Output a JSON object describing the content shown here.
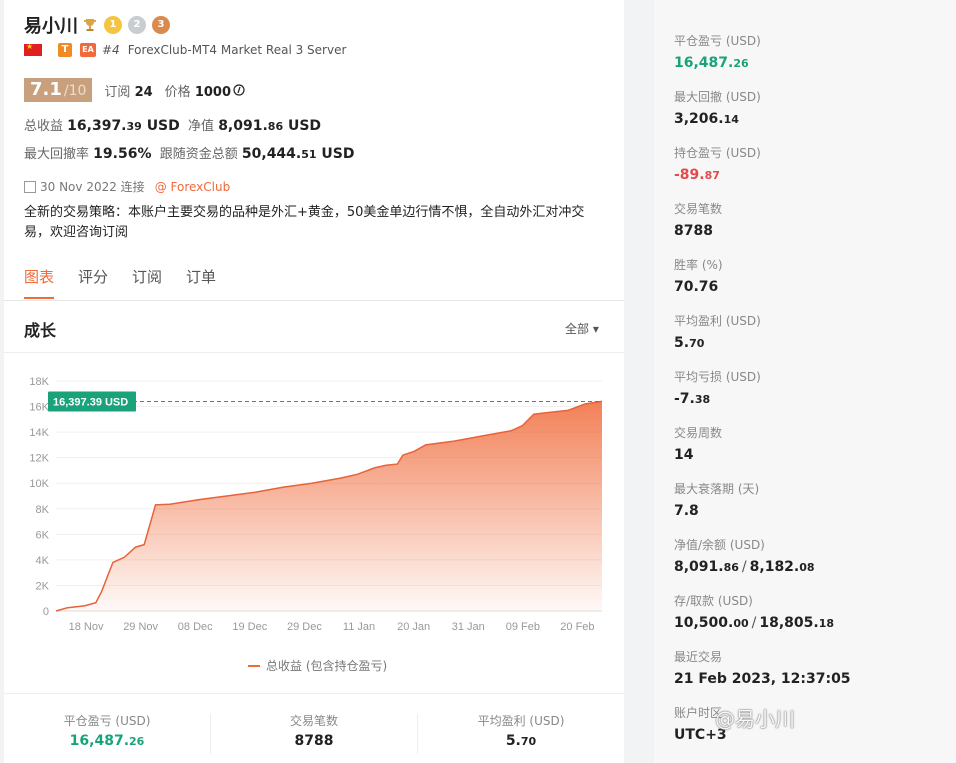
{
  "profile": {
    "name": "易小川",
    "rank": "#4",
    "server": "ForexClub-MT4 Market Real 3 Server",
    "tag_t": "T",
    "tag_ea": "EA",
    "medals": [
      "1",
      "2",
      "3"
    ],
    "score": "7.1",
    "score_den": "/10",
    "subscribe_label": "订阅",
    "subscribe_value": "24",
    "price_label": "价格",
    "price_value": "1000",
    "total_profit_label": "总收益",
    "total_profit_int": "16,397.",
    "total_profit_dec": "39",
    "total_profit_unit": "USD",
    "equity_label": "净值",
    "equity_int": "8,091.",
    "equity_dec": "86",
    "equity_unit": "USD",
    "max_dd_label": "最大回撤率",
    "max_dd_value": "19.56%",
    "follow_label": "跟随资金总额",
    "follow_int": "50,444.",
    "follow_dec": "51",
    "follow_unit": "USD",
    "date": "30 Nov 2022 连接",
    "broker_link": "@ ForexClub",
    "description": "全新的交易策略：本账户主要交易的品种是外汇+黄金，50美金单边行情不惧，全自动外汇对冲交易，欢迎咨询订阅"
  },
  "tabs": [
    {
      "label": "图表",
      "active": true
    },
    {
      "label": "评分",
      "active": false
    },
    {
      "label": "订阅",
      "active": false
    },
    {
      "label": "订单",
      "active": false
    }
  ],
  "growth": {
    "title": "成长",
    "filter": "全部 ▾",
    "legend": "总收益 (包含持仓盈亏)"
  },
  "chart_data": {
    "type": "area",
    "title": "",
    "xlabel": "",
    "ylabel": "",
    "ylim": [
      0,
      18000
    ],
    "y_ticks": [
      "0",
      "2K",
      "4K",
      "6K",
      "8K",
      "10K",
      "12K",
      "14K",
      "16K",
      "18K"
    ],
    "x_ticks": [
      "18 Nov",
      "29 Nov",
      "08 Dec",
      "19 Dec",
      "29 Dec",
      "11 Jan",
      "20 Jan",
      "31 Jan",
      "09 Feb",
      "20 Feb"
    ],
    "current_label": "16,397.39 USD",
    "current_value": 16397.39,
    "series": [
      {
        "name": "总收益 (包含持仓盈亏)",
        "points": [
          [
            0,
            0
          ],
          [
            0.2,
            250
          ],
          [
            0.5,
            400
          ],
          [
            0.7,
            650
          ],
          [
            0.8,
            1500
          ],
          [
            1.0,
            3800
          ],
          [
            1.2,
            4200
          ],
          [
            1.4,
            5000
          ],
          [
            1.55,
            5200
          ],
          [
            1.75,
            8300
          ],
          [
            2.0,
            8350
          ],
          [
            2.5,
            8700
          ],
          [
            3.0,
            9000
          ],
          [
            3.5,
            9300
          ],
          [
            4.0,
            9700
          ],
          [
            4.5,
            10000
          ],
          [
            5.0,
            10400
          ],
          [
            5.3,
            10700
          ],
          [
            5.6,
            11200
          ],
          [
            5.8,
            11400
          ],
          [
            6.0,
            11500
          ],
          [
            6.1,
            12200
          ],
          [
            6.3,
            12500
          ],
          [
            6.5,
            13000
          ],
          [
            7.0,
            13300
          ],
          [
            7.5,
            13700
          ],
          [
            8.0,
            14100
          ],
          [
            8.2,
            14500
          ],
          [
            8.4,
            15400
          ],
          [
            8.6,
            15500
          ],
          [
            9.0,
            15700
          ],
          [
            9.3,
            16200
          ],
          [
            9.6,
            16400
          ]
        ]
      }
    ]
  },
  "bottom_stats": [
    {
      "label": "平仓盈亏 (USD)",
      "int": "16,487.",
      "dec": "26",
      "color": "green"
    },
    {
      "label": "交易笔数",
      "int": "8788",
      "dec": "",
      "color": ""
    },
    {
      "label": "平均盈利 (USD)",
      "int": "5.",
      "dec": "70",
      "color": ""
    }
  ],
  "side_stats": [
    {
      "label": "平仓盈亏 (USD)",
      "int": "16,487.",
      "dec": "26",
      "color": "green"
    },
    {
      "label": "最大回撤 (USD)",
      "int": "3,206.",
      "dec": "14",
      "color": ""
    },
    {
      "label": "持仓盈亏 (USD)",
      "int": "-89.",
      "dec": "87",
      "color": "red"
    },
    {
      "label": "交易笔数",
      "int": "8788",
      "dec": "",
      "color": ""
    },
    {
      "label": "胜率 (%)",
      "int": "70.76",
      "dec": "",
      "color": ""
    },
    {
      "label": "平均盈利 (USD)",
      "int": "5.",
      "dec": "70",
      "color": ""
    },
    {
      "label": "平均亏损 (USD)",
      "int": "-7.",
      "dec": "38",
      "color": ""
    },
    {
      "label": "交易周数",
      "int": "14",
      "dec": "",
      "color": ""
    },
    {
      "label": "最大衰落期 (天)",
      "int": "7.8",
      "dec": "",
      "color": ""
    },
    {
      "label": "净值/余额 (USD)",
      "int": "8,091.",
      "dec": "86",
      "int2": "8,182.",
      "dec2": "08",
      "color": ""
    },
    {
      "label": "存/取款 (USD)",
      "int": "10,500.",
      "dec": "00",
      "int2": "18,805.",
      "dec2": "18",
      "color": ""
    },
    {
      "label": "最近交易",
      "int": "21 Feb 2023, 12:37:05",
      "dec": "",
      "color": ""
    },
    {
      "label": "账户时区",
      "int": "UTC+3",
      "dec": "",
      "color": ""
    }
  ],
  "watermark": "@易小川",
  "colors": {
    "accent": "#f06a3a",
    "green": "#1aa37a",
    "red": "#e34b4b",
    "score_bg": "#c9a07e"
  }
}
